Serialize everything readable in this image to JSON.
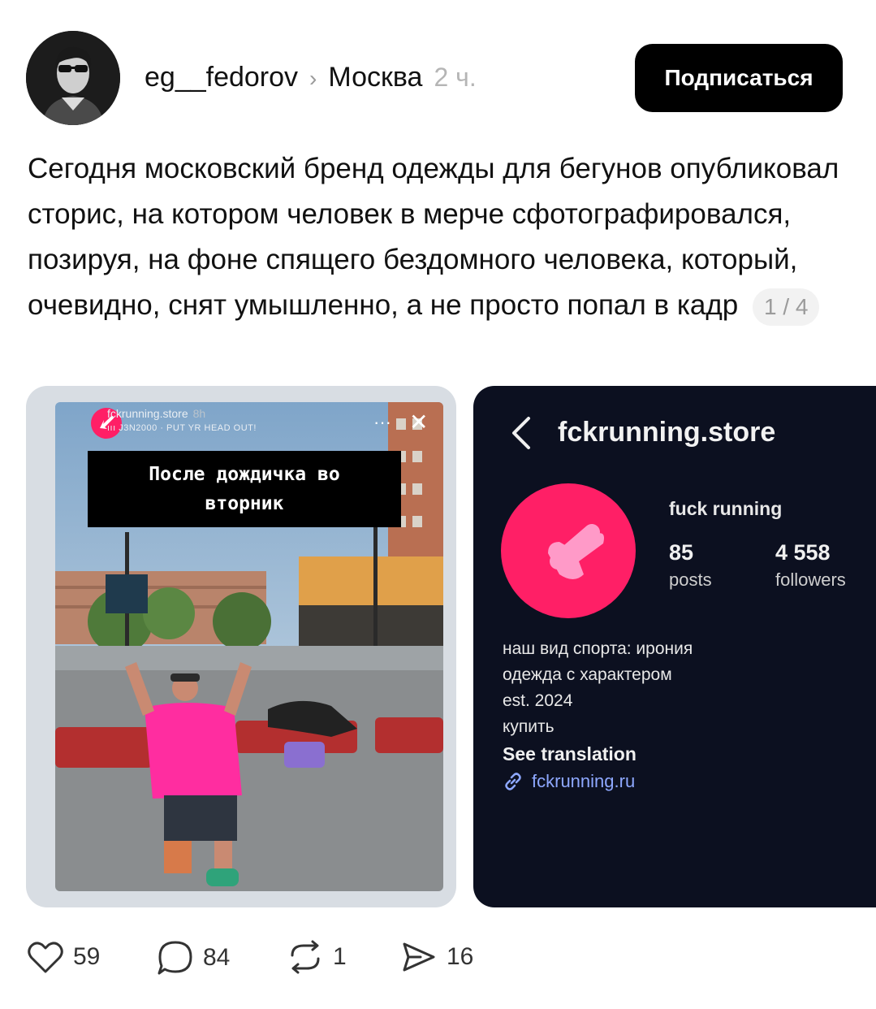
{
  "post": {
    "author": "eg__fedorov",
    "chevron": "›",
    "location": "Москва",
    "time": "2 ч.",
    "subscribe_label": "Подписаться",
    "text": "Сегодня московский бренд одежды для бегунов опубликовал сторис, на котором человек в мерче сфотографировался, позируя, на фоне спящего бездомного человека, который, очевидно, снят умышленно, а не просто попал в кадр",
    "page_counter": "1 / 4"
  },
  "story": {
    "account": "fckrunning.store",
    "time": "8h",
    "music": "ııı J3N2000 · PUT YR HEAD OUT!",
    "caption_line1": "После дождичка во",
    "caption_line2": "вторник",
    "close_icon": "close-icon",
    "more_icon": "more-dots-icon"
  },
  "profile": {
    "handle": "fckrunning.store",
    "name": "fuck running",
    "posts_count": "85",
    "posts_label": "posts",
    "followers_count": "4 558",
    "followers_label": "followers",
    "bio_line1": "наш вид спорта: ирония",
    "bio_line2": "одежда с характером",
    "bio_line3": "est. 2024",
    "bio_line4": "купить",
    "see_translation": "See translation",
    "link": "fckrunning.ru"
  },
  "actions": {
    "likes": "59",
    "comments": "84",
    "reposts": "1",
    "shares": "16"
  },
  "colors": {
    "brand_pink": "#ff1f66",
    "button_bg": "#000000",
    "profile_bg": "#0c1020"
  }
}
